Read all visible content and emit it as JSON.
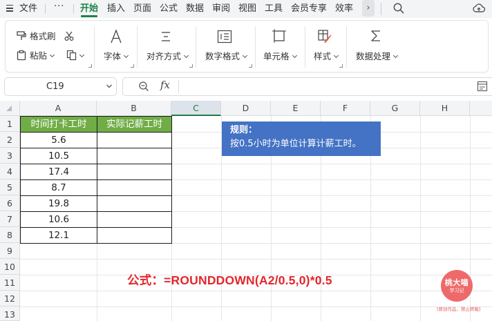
{
  "menubar": {
    "file": "文件",
    "more": "···",
    "tabs": [
      "开始",
      "插入",
      "页面",
      "公式",
      "数据",
      "审阅",
      "视图",
      "工具",
      "会员专享",
      "效率"
    ],
    "active_tab": "开始",
    "more_tabs": "›",
    "icons": [
      "hamburger-icon",
      "search-icon",
      "cloud-upload-icon"
    ]
  },
  "ribbon": {
    "format_painter": "格式刷",
    "paste": "粘贴",
    "font": "字体",
    "align": "对齐方式",
    "number_format": "数字格式",
    "cell": "单元格",
    "style": "样式",
    "data_process": "数据处理",
    "icons": [
      "brush-icon",
      "scissors-icon",
      "paste-icon",
      "copy-icon",
      "font-icon",
      "align-icon",
      "number-format-icon",
      "cell-icon",
      "style-icon",
      "sum-icon"
    ]
  },
  "formula_bar": {
    "cell_ref": "C19",
    "fx": "fx",
    "content": ""
  },
  "grid": {
    "columns": [
      "A",
      "B",
      "C",
      "D",
      "E",
      "F",
      "G",
      "H"
    ],
    "rows": [
      "1",
      "2",
      "3",
      "4",
      "5",
      "6",
      "7",
      "8",
      "9",
      "10",
      "11",
      "12",
      "13"
    ],
    "active_column": "C",
    "header": [
      "时间打卡工时",
      "实际记薪工时"
    ],
    "values": [
      "5.6",
      "10.5",
      "17.4",
      "8.7",
      "19.8",
      "10.6",
      "12.1"
    ]
  },
  "rule": {
    "title": "规则：",
    "body": "按0.5小时为单位计算计薪工时。"
  },
  "formula_note": "公式：=ROUNDDOWN(A2/0.5,0)*0.5",
  "watermark": {
    "line1": "桃大喵",
    "line2": "学习记",
    "caption": "[原创作品，禁止转载]"
  },
  "colors": {
    "accent_green": "#1d8348",
    "header_green": "#70ad47",
    "rule_blue": "#4472c4",
    "formula_red": "#e3262d",
    "watermark_red": "#ee6a6a"
  }
}
